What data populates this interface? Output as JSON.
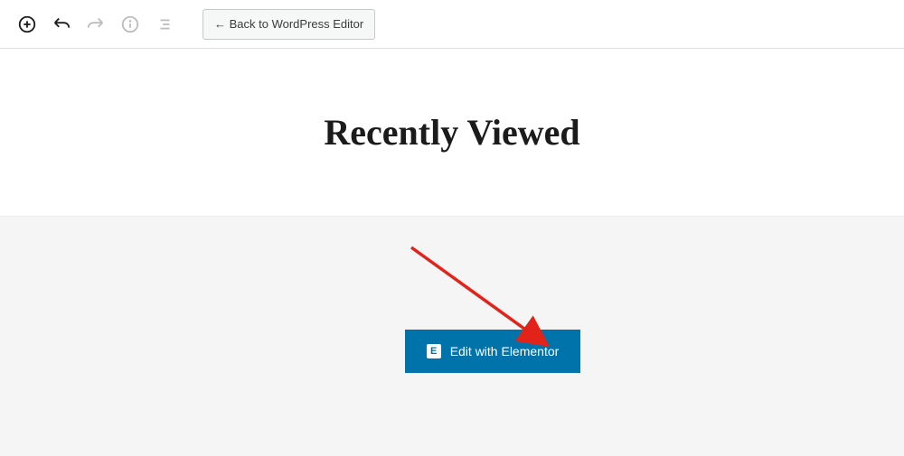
{
  "toolbar": {
    "back_label": "← Back to WordPress Editor"
  },
  "title": "Recently Viewed",
  "elementor": {
    "button_label": "Edit with Elementor",
    "icon_letter": "E"
  }
}
